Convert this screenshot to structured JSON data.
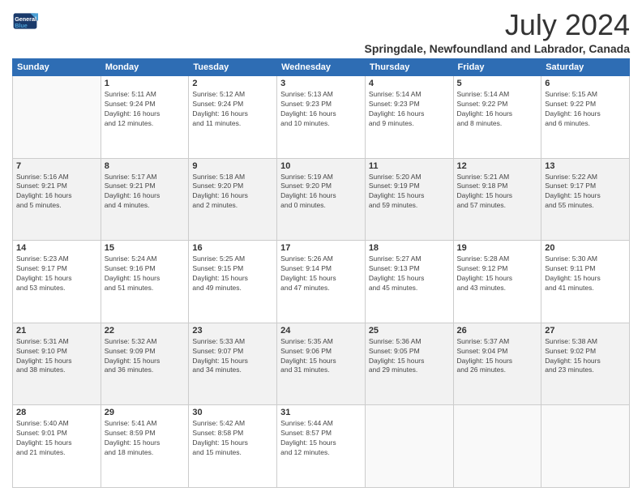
{
  "header": {
    "logo_line1": "General",
    "logo_line2": "Blue",
    "month_title": "July 2024",
    "subtitle": "Springdale, Newfoundland and Labrador, Canada"
  },
  "weekdays": [
    "Sunday",
    "Monday",
    "Tuesday",
    "Wednesday",
    "Thursday",
    "Friday",
    "Saturday"
  ],
  "weeks": [
    [
      {
        "day": "",
        "info": ""
      },
      {
        "day": "1",
        "info": "Sunrise: 5:11 AM\nSunset: 9:24 PM\nDaylight: 16 hours\nand 12 minutes."
      },
      {
        "day": "2",
        "info": "Sunrise: 5:12 AM\nSunset: 9:24 PM\nDaylight: 16 hours\nand 11 minutes."
      },
      {
        "day": "3",
        "info": "Sunrise: 5:13 AM\nSunset: 9:23 PM\nDaylight: 16 hours\nand 10 minutes."
      },
      {
        "day": "4",
        "info": "Sunrise: 5:14 AM\nSunset: 9:23 PM\nDaylight: 16 hours\nand 9 minutes."
      },
      {
        "day": "5",
        "info": "Sunrise: 5:14 AM\nSunset: 9:22 PM\nDaylight: 16 hours\nand 8 minutes."
      },
      {
        "day": "6",
        "info": "Sunrise: 5:15 AM\nSunset: 9:22 PM\nDaylight: 16 hours\nand 6 minutes."
      }
    ],
    [
      {
        "day": "7",
        "info": "Sunrise: 5:16 AM\nSunset: 9:21 PM\nDaylight: 16 hours\nand 5 minutes."
      },
      {
        "day": "8",
        "info": "Sunrise: 5:17 AM\nSunset: 9:21 PM\nDaylight: 16 hours\nand 4 minutes."
      },
      {
        "day": "9",
        "info": "Sunrise: 5:18 AM\nSunset: 9:20 PM\nDaylight: 16 hours\nand 2 minutes."
      },
      {
        "day": "10",
        "info": "Sunrise: 5:19 AM\nSunset: 9:20 PM\nDaylight: 16 hours\nand 0 minutes."
      },
      {
        "day": "11",
        "info": "Sunrise: 5:20 AM\nSunset: 9:19 PM\nDaylight: 15 hours\nand 59 minutes."
      },
      {
        "day": "12",
        "info": "Sunrise: 5:21 AM\nSunset: 9:18 PM\nDaylight: 15 hours\nand 57 minutes."
      },
      {
        "day": "13",
        "info": "Sunrise: 5:22 AM\nSunset: 9:17 PM\nDaylight: 15 hours\nand 55 minutes."
      }
    ],
    [
      {
        "day": "14",
        "info": "Sunrise: 5:23 AM\nSunset: 9:17 PM\nDaylight: 15 hours\nand 53 minutes."
      },
      {
        "day": "15",
        "info": "Sunrise: 5:24 AM\nSunset: 9:16 PM\nDaylight: 15 hours\nand 51 minutes."
      },
      {
        "day": "16",
        "info": "Sunrise: 5:25 AM\nSunset: 9:15 PM\nDaylight: 15 hours\nand 49 minutes."
      },
      {
        "day": "17",
        "info": "Sunrise: 5:26 AM\nSunset: 9:14 PM\nDaylight: 15 hours\nand 47 minutes."
      },
      {
        "day": "18",
        "info": "Sunrise: 5:27 AM\nSunset: 9:13 PM\nDaylight: 15 hours\nand 45 minutes."
      },
      {
        "day": "19",
        "info": "Sunrise: 5:28 AM\nSunset: 9:12 PM\nDaylight: 15 hours\nand 43 minutes."
      },
      {
        "day": "20",
        "info": "Sunrise: 5:30 AM\nSunset: 9:11 PM\nDaylight: 15 hours\nand 41 minutes."
      }
    ],
    [
      {
        "day": "21",
        "info": "Sunrise: 5:31 AM\nSunset: 9:10 PM\nDaylight: 15 hours\nand 38 minutes."
      },
      {
        "day": "22",
        "info": "Sunrise: 5:32 AM\nSunset: 9:09 PM\nDaylight: 15 hours\nand 36 minutes."
      },
      {
        "day": "23",
        "info": "Sunrise: 5:33 AM\nSunset: 9:07 PM\nDaylight: 15 hours\nand 34 minutes."
      },
      {
        "day": "24",
        "info": "Sunrise: 5:35 AM\nSunset: 9:06 PM\nDaylight: 15 hours\nand 31 minutes."
      },
      {
        "day": "25",
        "info": "Sunrise: 5:36 AM\nSunset: 9:05 PM\nDaylight: 15 hours\nand 29 minutes."
      },
      {
        "day": "26",
        "info": "Sunrise: 5:37 AM\nSunset: 9:04 PM\nDaylight: 15 hours\nand 26 minutes."
      },
      {
        "day": "27",
        "info": "Sunrise: 5:38 AM\nSunset: 9:02 PM\nDaylight: 15 hours\nand 23 minutes."
      }
    ],
    [
      {
        "day": "28",
        "info": "Sunrise: 5:40 AM\nSunset: 9:01 PM\nDaylight: 15 hours\nand 21 minutes."
      },
      {
        "day": "29",
        "info": "Sunrise: 5:41 AM\nSunset: 8:59 PM\nDaylight: 15 hours\nand 18 minutes."
      },
      {
        "day": "30",
        "info": "Sunrise: 5:42 AM\nSunset: 8:58 PM\nDaylight: 15 hours\nand 15 minutes."
      },
      {
        "day": "31",
        "info": "Sunrise: 5:44 AM\nSunset: 8:57 PM\nDaylight: 15 hours\nand 12 minutes."
      },
      {
        "day": "",
        "info": ""
      },
      {
        "day": "",
        "info": ""
      },
      {
        "day": "",
        "info": ""
      }
    ]
  ]
}
